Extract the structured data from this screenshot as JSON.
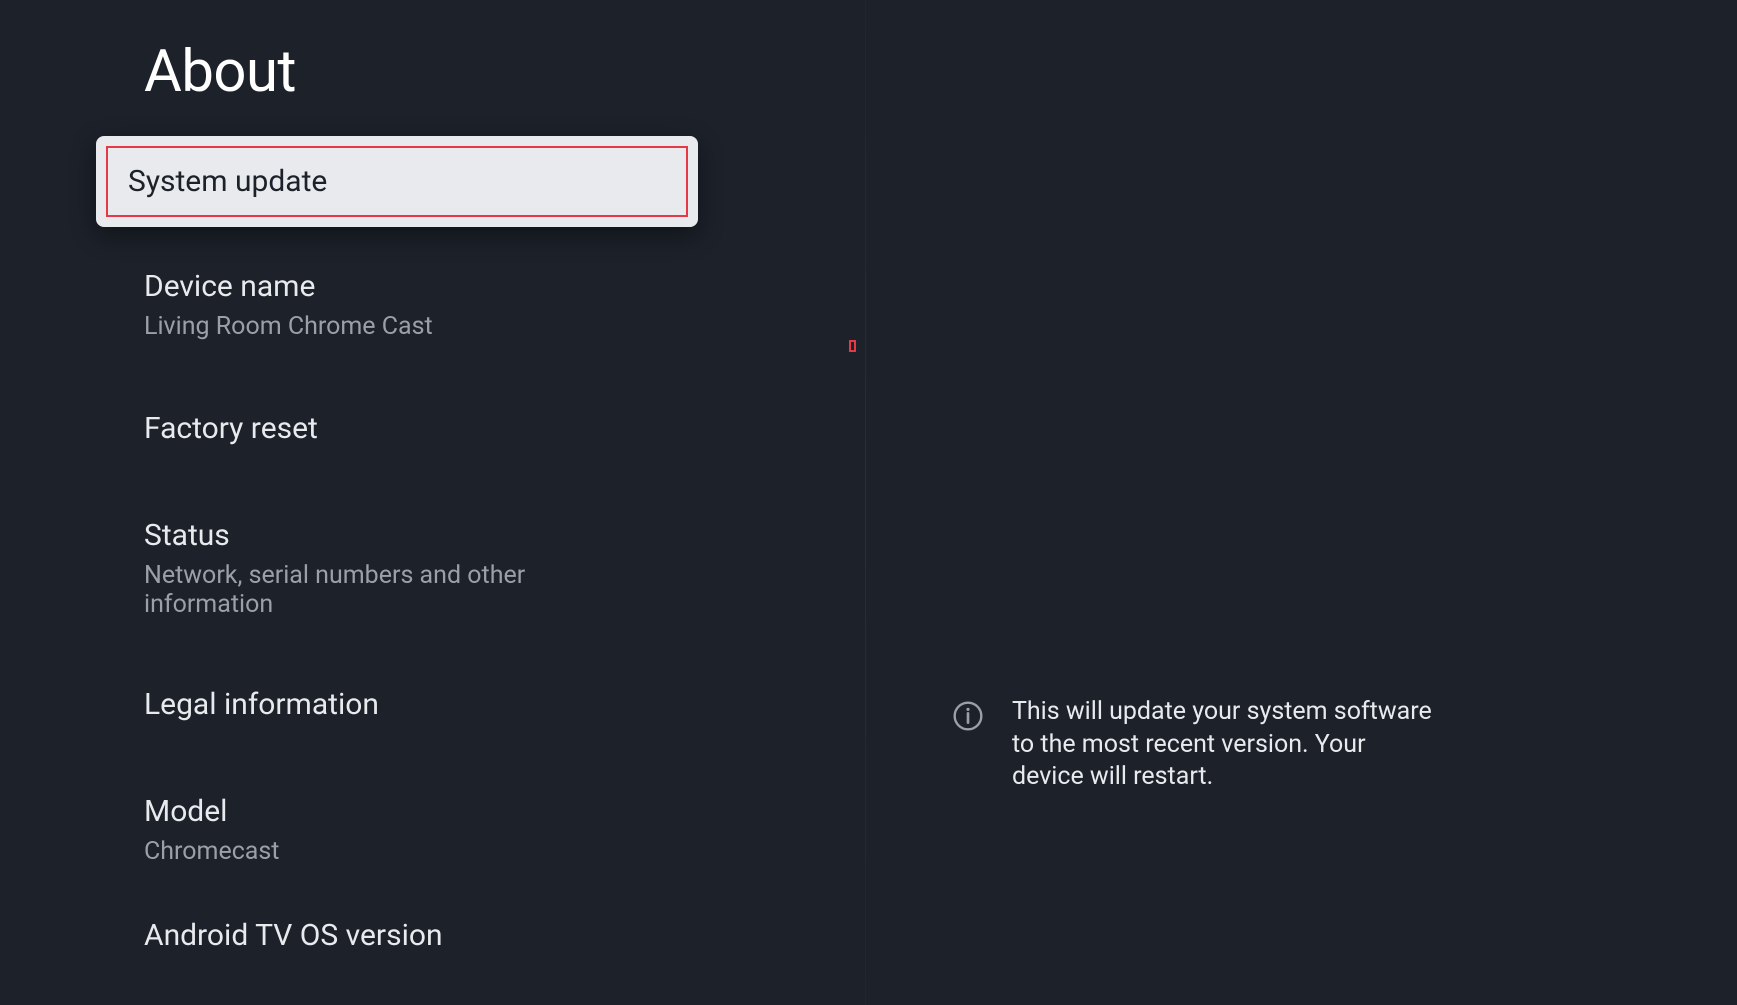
{
  "page_title": "About",
  "menu": {
    "items": [
      {
        "title": "System update",
        "subtitle": null,
        "focused": true
      },
      {
        "title": "Device name",
        "subtitle": "Living Room Chrome Cast",
        "focused": false
      },
      {
        "title": "Factory reset",
        "subtitle": null,
        "focused": false
      },
      {
        "title": "Status",
        "subtitle": "Network, serial numbers and other information",
        "focused": false
      },
      {
        "title": "Legal information",
        "subtitle": null,
        "focused": false
      },
      {
        "title": "Model",
        "subtitle": "Chromecast",
        "focused": false
      },
      {
        "title": "Android TV OS version",
        "subtitle": null,
        "focused": false
      }
    ]
  },
  "info": {
    "text": "This will update your system software to the most recent version. Your device will restart."
  }
}
